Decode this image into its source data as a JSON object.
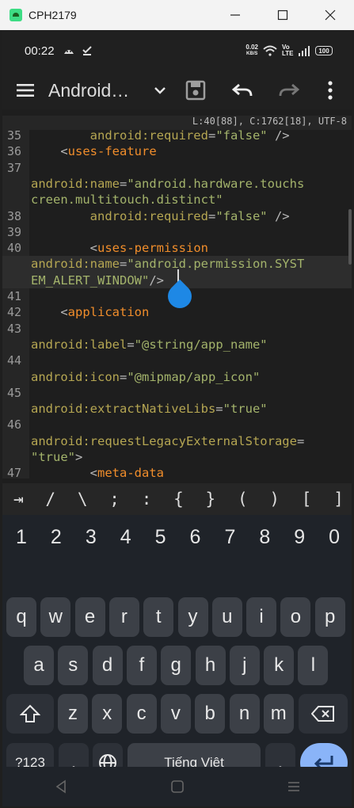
{
  "window": {
    "title": "CPH2179",
    "minimize": "—",
    "maximize": "☐",
    "close": "✕"
  },
  "status_bar": {
    "time": "00:22",
    "net_speed_value": "0.02",
    "net_speed_unit": "KB/S",
    "lte_label": "Vo LTE",
    "battery": "100"
  },
  "toolbar": {
    "title": "Android…",
    "menu_icon": "hamburger-menu-icon",
    "dropdown_icon": "chevron-down-icon",
    "save_icon": "save-icon",
    "undo_icon": "undo-icon",
    "redo_icon": "redo-icon",
    "more_icon": "more-vertical-icon"
  },
  "editor": {
    "position_info": "L:40[88], C:1762[18], UTF-8",
    "rows": [
      {
        "ln": "35",
        "segments": [
          {
            "t": "        ",
            "c": "t-punc"
          },
          {
            "t": "android:required",
            "c": "t-attr"
          },
          {
            "t": "=",
            "c": "t-punc"
          },
          {
            "t": "\"false\"",
            "c": "t-str"
          },
          {
            "t": " />",
            "c": "t-punc"
          }
        ]
      },
      {
        "ln": "36",
        "segments": [
          {
            "t": "    <",
            "c": "t-punc"
          },
          {
            "t": "uses-feature",
            "c": "t-tag"
          }
        ]
      },
      {
        "ln": "37",
        "segments": []
      },
      {
        "ln": "",
        "segments": [
          {
            "t": "android:name",
            "c": "t-attr"
          },
          {
            "t": "=",
            "c": "t-punc"
          },
          {
            "t": "\"android.hardware.touchs",
            "c": "t-str"
          }
        ]
      },
      {
        "ln": "",
        "segments": [
          {
            "t": "creen.multitouch.distinct\"",
            "c": "t-str"
          }
        ]
      },
      {
        "ln": "38",
        "segments": [
          {
            "t": "        ",
            "c": "t-punc"
          },
          {
            "t": "android:required",
            "c": "t-attr"
          },
          {
            "t": "=",
            "c": "t-punc"
          },
          {
            "t": "\"false\"",
            "c": "t-str"
          },
          {
            "t": " />",
            "c": "t-punc"
          }
        ]
      },
      {
        "ln": "39",
        "segments": []
      },
      {
        "ln": "40",
        "segments": [
          {
            "t": "        <",
            "c": "t-punc"
          },
          {
            "t": "uses-permission",
            "c": "t-tag"
          }
        ]
      },
      {
        "ln": "",
        "segments": [
          {
            "t": "android:name",
            "c": "t-attr"
          },
          {
            "t": "=",
            "c": "t-punc"
          },
          {
            "t": "\"android.permission.SYST",
            "c": "t-str"
          }
        ],
        "current": true
      },
      {
        "ln": "",
        "segments": [
          {
            "t": "EM_ALERT_WINDOW\"",
            "c": "t-str"
          },
          {
            "t": "/>",
            "c": "t-punc"
          }
        ],
        "current": true
      },
      {
        "ln": "41",
        "segments": []
      },
      {
        "ln": "42",
        "segments": [
          {
            "t": "    <",
            "c": "t-punc"
          },
          {
            "t": "application",
            "c": "t-tag"
          }
        ]
      },
      {
        "ln": "43",
        "segments": []
      },
      {
        "ln": "",
        "segments": [
          {
            "t": "android:label",
            "c": "t-attr"
          },
          {
            "t": "=",
            "c": "t-punc"
          },
          {
            "t": "\"@string/app_name\"",
            "c": "t-str"
          }
        ]
      },
      {
        "ln": "44",
        "segments": []
      },
      {
        "ln": "",
        "segments": [
          {
            "t": "android:icon",
            "c": "t-attr"
          },
          {
            "t": "=",
            "c": "t-punc"
          },
          {
            "t": "\"@mipmap/app_icon\"",
            "c": "t-str"
          }
        ]
      },
      {
        "ln": "45",
        "segments": []
      },
      {
        "ln": "",
        "segments": [
          {
            "t": "android:extractNativeLibs",
            "c": "t-attr"
          },
          {
            "t": "=",
            "c": "t-punc"
          },
          {
            "t": "\"true\"",
            "c": "t-str"
          }
        ]
      },
      {
        "ln": "46",
        "segments": []
      },
      {
        "ln": "",
        "segments": [
          {
            "t": "android:requestLegacyExternalStorage",
            "c": "t-attr"
          },
          {
            "t": "=",
            "c": "t-punc"
          }
        ]
      },
      {
        "ln": "",
        "segments": [
          {
            "t": "\"true\"",
            "c": "t-str"
          },
          {
            "t": ">",
            "c": "t-punc"
          }
        ]
      },
      {
        "ln": "47",
        "segments": [
          {
            "t": "        <",
            "c": "t-punc"
          },
          {
            "t": "meta-data",
            "c": "t-tag"
          }
        ]
      }
    ]
  },
  "symbols": [
    "⇥",
    "/",
    "\\",
    ";",
    ":",
    "{",
    "}",
    "(",
    ")",
    "[",
    "]"
  ],
  "keyboard": {
    "numbers": [
      "1",
      "2",
      "3",
      "4",
      "5",
      "6",
      "7",
      "8",
      "9",
      "0"
    ],
    "row1": [
      "q",
      "w",
      "e",
      "r",
      "t",
      "y",
      "u",
      "i",
      "o",
      "p"
    ],
    "row2": [
      "a",
      "s",
      "d",
      "f",
      "g",
      "h",
      "j",
      "k",
      "l"
    ],
    "row3": [
      "z",
      "x",
      "c",
      "v",
      "b",
      "n",
      "m"
    ],
    "symbols_key": "?123",
    "comma": ",",
    "space_label": "Tiếng Việt",
    "period": "."
  },
  "colors": {
    "tag": "#f08d2b",
    "attribute": "#b5a652",
    "string": "#a3b36b",
    "cursor_handle": "#1e88e5",
    "enter_key": "#8ab4f8"
  }
}
